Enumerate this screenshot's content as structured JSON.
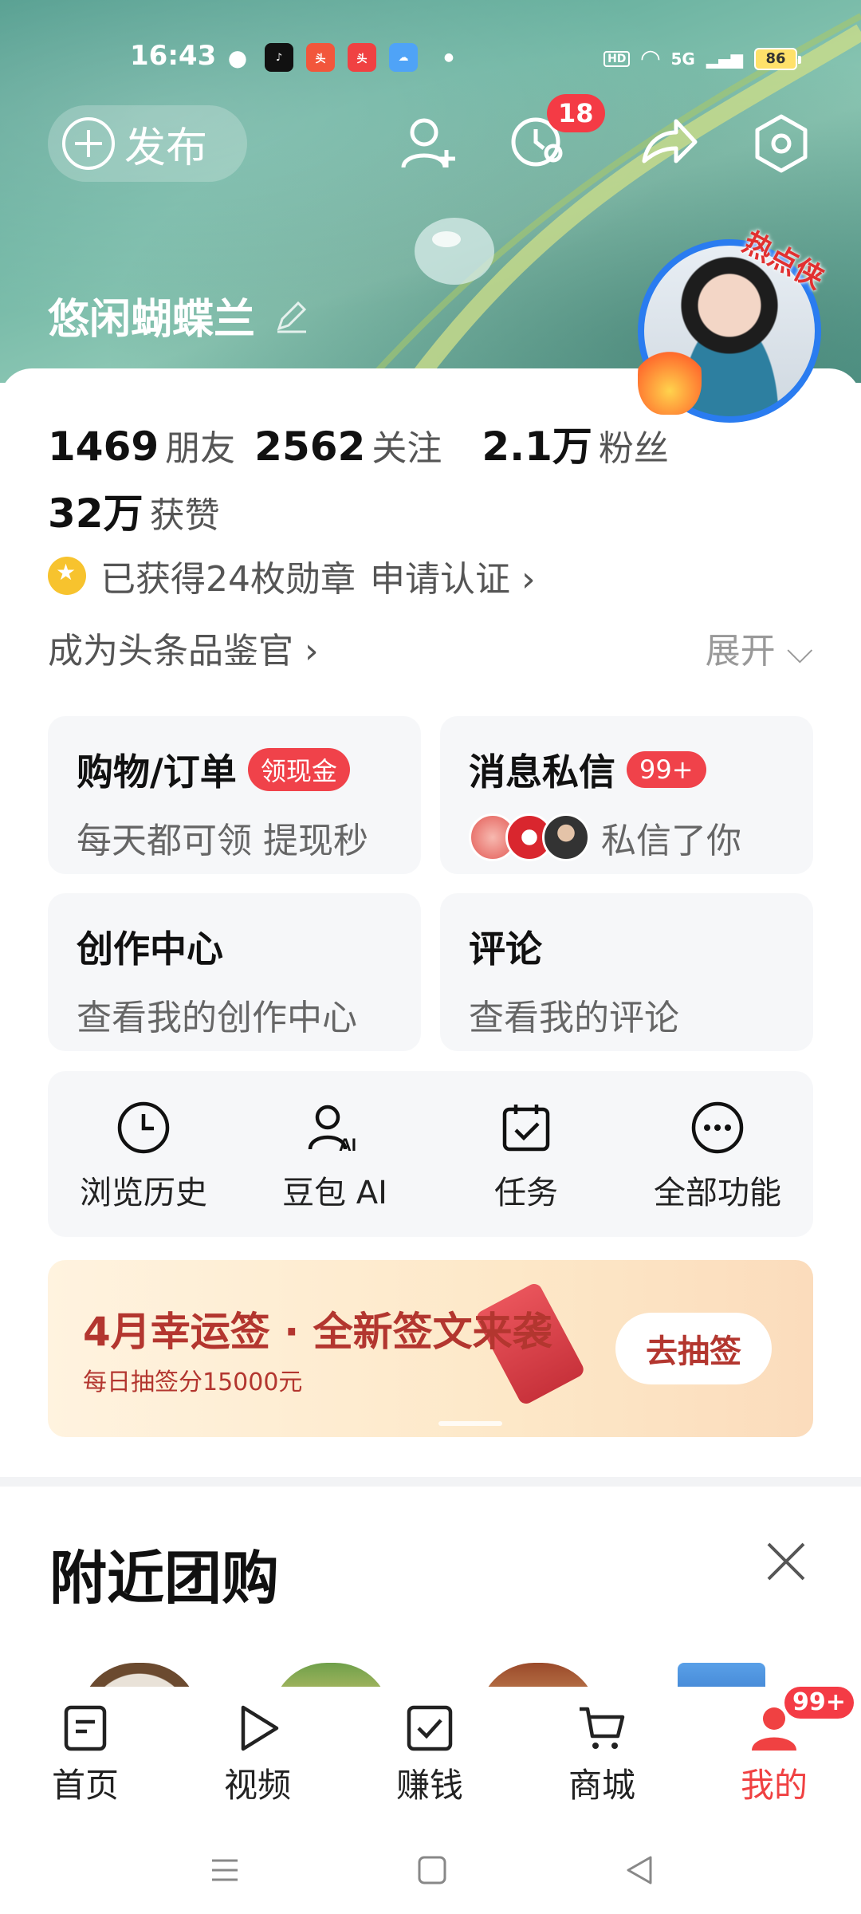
{
  "status_bar": {
    "time": "16:43",
    "apps": [
      "wechat",
      "douyin",
      "toutiao-lite",
      "头条",
      "weather"
    ],
    "network": "5G",
    "battery": "86"
  },
  "header": {
    "publish_label": "发布",
    "notifications_badge": "18",
    "username": "悠闲蝴蝶兰",
    "avatar_tag": "热点侠"
  },
  "stats": {
    "friends_num": "1469",
    "friends_label": "朋友",
    "following_num": "2562",
    "following_label": "关注",
    "fans_num": "2.1万",
    "fans_label": "粉丝",
    "likes_num": "32万",
    "likes_label": "获赞"
  },
  "medals": {
    "text": "已获得24枚勋章",
    "apply": "申请认证 ›"
  },
  "pinjian": {
    "text": "成为头条品鉴官 ›",
    "expand": "展开 ⌵"
  },
  "cards": {
    "shop": {
      "title": "购物/订单",
      "pill": "领现金",
      "sub": "每天都可领 提现秒"
    },
    "message": {
      "title": "消息私信",
      "pill": "99+",
      "sub": "私信了你"
    },
    "create": {
      "title": "创作中心",
      "sub": "查看我的创作中心"
    },
    "comment": {
      "title": "评论",
      "sub": "查看我的评论"
    }
  },
  "functions": [
    {
      "label": "浏览历史",
      "icon": "clock-icon"
    },
    {
      "label": "豆包 AI",
      "icon": "ai-user-icon"
    },
    {
      "label": "任务",
      "icon": "calendar-check-icon"
    },
    {
      "label": "全部功能",
      "icon": "more-circle-icon"
    }
  ],
  "banner": {
    "title": "4月幸运签 · 全新签文来袭",
    "sub": "每日抽签分15000元",
    "button": "去抽签"
  },
  "nearby": {
    "title": "附近团购"
  },
  "bottom_nav": [
    {
      "label": "首页",
      "icon": "home-icon"
    },
    {
      "label": "视频",
      "icon": "video-icon"
    },
    {
      "label": "赚钱",
      "icon": "earn-icon"
    },
    {
      "label": "商城",
      "icon": "cart-icon"
    },
    {
      "label": "我的",
      "icon": "profile-icon",
      "badge": "99+",
      "active": true
    }
  ],
  "colors": {
    "accent": "#f04142",
    "badge": "#f43b45",
    "card_bg": "#f6f7f9",
    "banner_text": "#b3362f"
  }
}
